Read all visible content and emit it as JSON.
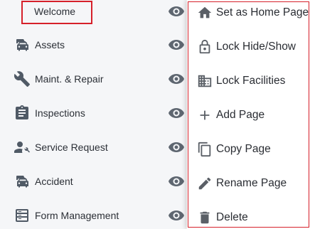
{
  "nav": {
    "items": [
      {
        "label": "Welcome",
        "icon": "home-icon"
      },
      {
        "label": "Assets",
        "icon": "vehicles-icon"
      },
      {
        "label": "Maint. & Repair",
        "icon": "wrench-icon"
      },
      {
        "label": "Inspections",
        "icon": "clipboard-icon"
      },
      {
        "label": "Service Request",
        "icon": "person-wrench-icon"
      },
      {
        "label": "Accident",
        "icon": "vehicles-icon"
      },
      {
        "label": "Form Management",
        "icon": "form-icon"
      }
    ]
  },
  "context_menu": {
    "items": [
      {
        "label": "Set as Home Page",
        "icon": "home-icon"
      },
      {
        "label": "Lock Hide/Show",
        "icon": "lock-icon"
      },
      {
        "label": "Lock Facilities",
        "icon": "building-icon"
      },
      {
        "label": "Add Page",
        "icon": "plus-icon"
      },
      {
        "label": "Copy Page",
        "icon": "copy-icon"
      },
      {
        "label": "Rename Page",
        "icon": "pencil-icon"
      },
      {
        "label": "Delete",
        "icon": "trash-icon"
      }
    ]
  },
  "colors": {
    "highlight_border": "#d6202a",
    "nav_background": "#f5f6f8",
    "icon_gray": "#505a66"
  }
}
